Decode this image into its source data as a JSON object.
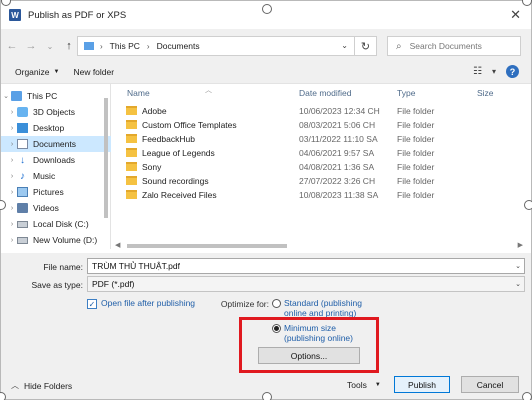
{
  "window": {
    "title": "Publish as PDF or XPS",
    "app_icon": "W",
    "close_glyph": "✕"
  },
  "nav": {
    "back": "←",
    "forward": "→",
    "recent": "⌄",
    "up": "↑"
  },
  "address": {
    "crumbs": [
      "This PC",
      "Documents"
    ],
    "separator": "›",
    "dropdown": "⌄",
    "refresh": "↻"
  },
  "search": {
    "placeholder": "Search Documents",
    "icon": "⌕"
  },
  "toolbar": {
    "organize": "Organize",
    "new_folder": "New folder",
    "views": "☷",
    "views_caret": "▾",
    "help": "?"
  },
  "sidebar": {
    "items": [
      {
        "label": "This PC",
        "icon": "pc-icon"
      },
      {
        "label": "3D Objects",
        "icon": "cube-icon"
      },
      {
        "label": "Desktop",
        "icon": "desktop-icon"
      },
      {
        "label": "Documents",
        "icon": "document-icon"
      },
      {
        "label": "Downloads",
        "icon": "download-icon"
      },
      {
        "label": "Music",
        "icon": "music-icon"
      },
      {
        "label": "Pictures",
        "icon": "picture-icon"
      },
      {
        "label": "Videos",
        "icon": "video-icon"
      },
      {
        "label": "Local Disk (C:)",
        "icon": "disk-icon"
      },
      {
        "label": "New Volume (D:)",
        "icon": "disk-icon"
      }
    ],
    "selected_index": 3
  },
  "columns": {
    "name": "Name",
    "date": "Date modified",
    "type": "Type",
    "size": "Size"
  },
  "files": [
    {
      "name": "Adobe",
      "date": "10/06/2023 12:34 CH",
      "type": "File folder"
    },
    {
      "name": "Custom Office Templates",
      "date": "08/03/2021 5:06 CH",
      "type": "File folder"
    },
    {
      "name": "FeedbackHub",
      "date": "03/11/2022 11:10 SA",
      "type": "File folder"
    },
    {
      "name": "League of Legends",
      "date": "04/06/2021 9:57 SA",
      "type": "File folder"
    },
    {
      "name": "Sony",
      "date": "04/08/2021 1:36 SA",
      "type": "File folder"
    },
    {
      "name": "Sound recordings",
      "date": "27/07/2022 3:26 CH",
      "type": "File folder"
    },
    {
      "name": "Zalo Received Files",
      "date": "10/08/2023 11:38 SA",
      "type": "File folder"
    }
  ],
  "form": {
    "file_name_label": "File name:",
    "file_name_value": "TRÙM THỦ THUẬT.pdf",
    "save_type_label": "Save as type:",
    "save_type_value": "PDF (*.pdf)",
    "open_after_label": "Open file after publishing",
    "open_after_checked": true,
    "optimize_label": "Optimize for:",
    "option_standard_line1": "Standard (publishing",
    "option_standard_line2": "online and printing)",
    "option_minimum_line1": "Minimum size",
    "option_minimum_line2": "(publishing online)",
    "selected_option": "minimum",
    "options_button": "Options..."
  },
  "footer": {
    "hide_folders": "Hide Folders",
    "tools": "Tools",
    "publish": "Publish",
    "cancel": "Cancel"
  },
  "colors": {
    "highlight_box": "#e0191f",
    "selection": "#cce8ff",
    "link_text": "#1f5ea8"
  }
}
